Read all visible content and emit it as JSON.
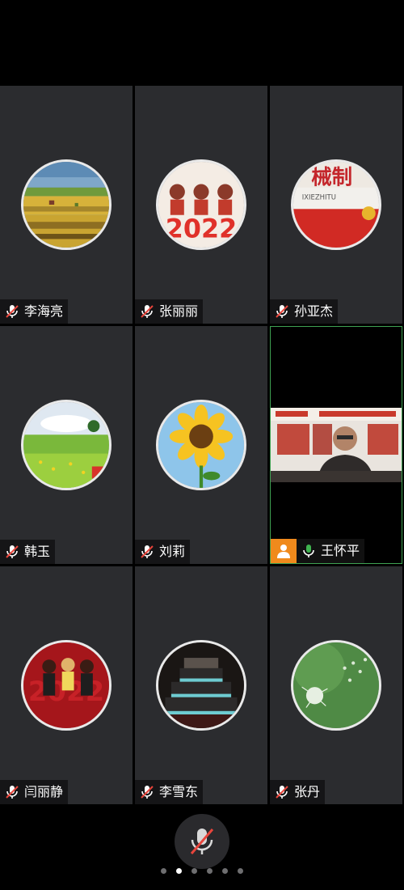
{
  "participants": [
    {
      "name": "李海亮",
      "muted": true,
      "avatar": "field-painting"
    },
    {
      "name": "张丽丽",
      "muted": true,
      "avatar": "2022-cartoon"
    },
    {
      "name": "孙亚杰",
      "muted": true,
      "avatar": "banner-photo"
    },
    {
      "name": "韩玉",
      "muted": true,
      "avatar": "flower-meadow"
    },
    {
      "name": "刘莉",
      "muted": true,
      "avatar": "sunflower"
    },
    {
      "name": "王怀平",
      "muted": false,
      "video": true,
      "speaking": true
    },
    {
      "name": "闫丽静",
      "muted": true,
      "avatar": "2022-cartoon-red"
    },
    {
      "name": "李雪东",
      "muted": true,
      "avatar": "birthday-cake"
    },
    {
      "name": "张丹",
      "muted": true,
      "avatar": "dandelion"
    }
  ],
  "avatar_texts": {
    "zhang_lili": "2022",
    "sun_yajie_banner": "械制",
    "sun_yajie_sub": "IXIEZHITU",
    "yan_lijing": "2022"
  },
  "controls": {
    "mute_icon": "mic-muted-icon",
    "pages": 6,
    "current_page": 2
  },
  "colors": {
    "tile_bg": "#2b2c2f",
    "active_border": "#3fa152",
    "user_badge": "#f08a1c",
    "mute_slash": "#e8453c"
  }
}
